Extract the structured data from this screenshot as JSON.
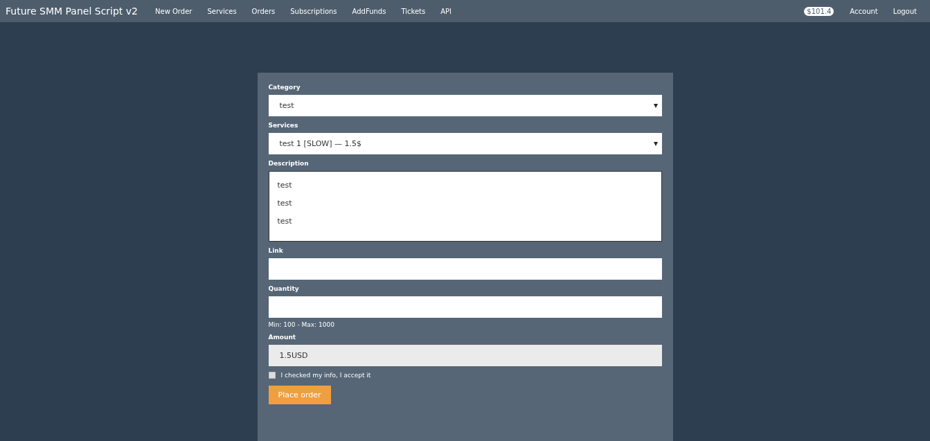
{
  "navbar": {
    "brand": "Future SMM Panel Script v2",
    "links": [
      "New Order",
      "Services",
      "Orders",
      "Subscriptions",
      "AddFunds",
      "Tickets",
      "API"
    ],
    "balance": "$101.4",
    "right_links": [
      "Account",
      "Logout"
    ]
  },
  "form": {
    "fields": [
      {
        "kind": "select",
        "label": "Category",
        "value": "test"
      },
      {
        "kind": "select",
        "label": "Services",
        "value": "test 1 [SLOW] — 1.5$"
      },
      {
        "kind": "textarea",
        "label": "Description",
        "lines": [
          "test",
          "test",
          "test"
        ]
      },
      {
        "kind": "input",
        "label": "Link"
      },
      {
        "kind": "input",
        "label": "Quantity",
        "help": "Min: 100 - Max: 1000"
      },
      {
        "kind": "readonly",
        "label": "Amount",
        "value": "1.5USD"
      }
    ],
    "agree": {
      "label": "I checked my info, I accept it",
      "checked": false
    },
    "submit": "Place order"
  }
}
